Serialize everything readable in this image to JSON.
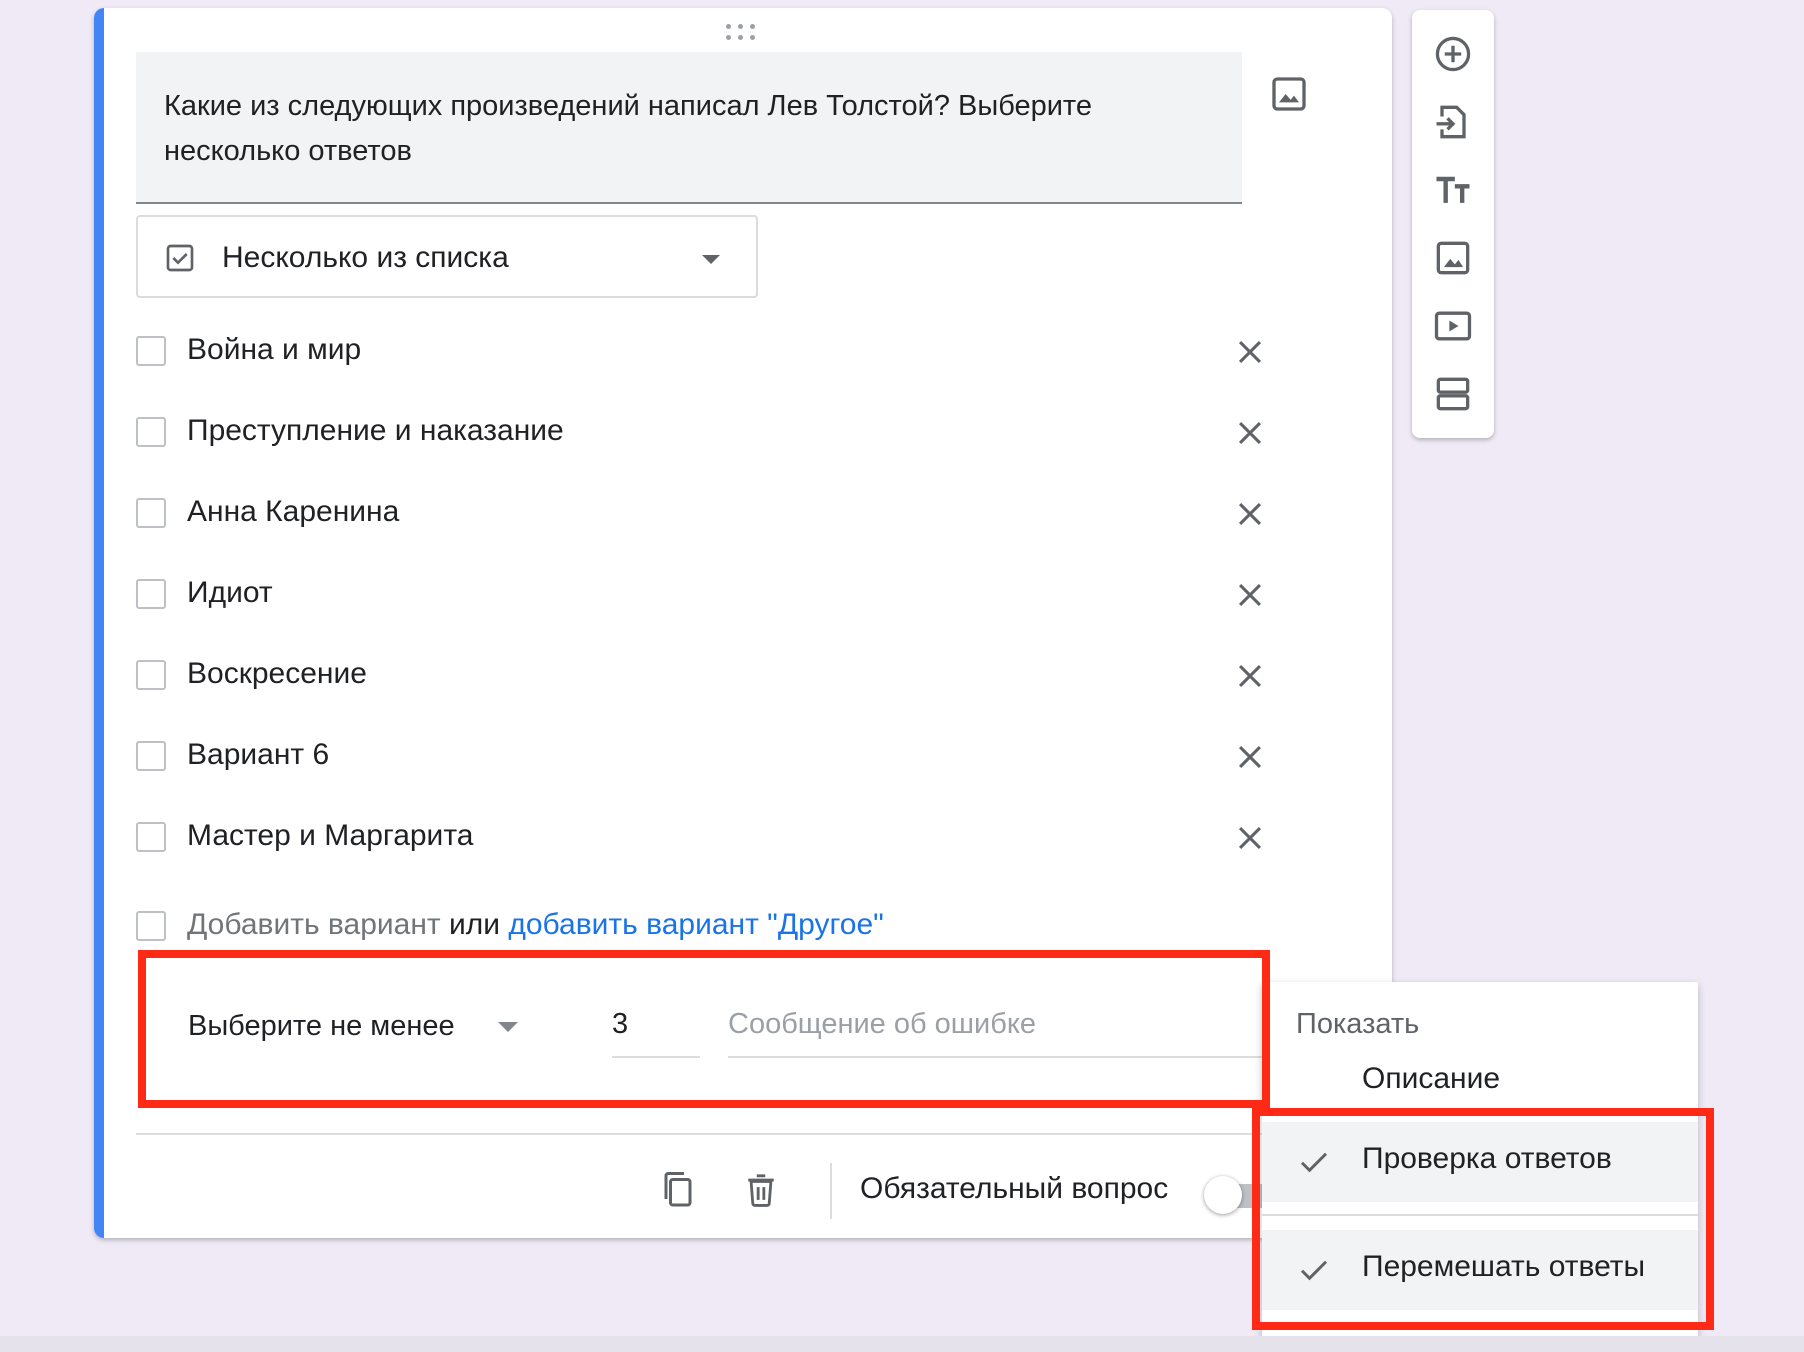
{
  "question": {
    "title": "Какие из следующих произведений написал Лев Толстой? Выберите несколько ответов",
    "type_label": "Несколько из списка"
  },
  "options": [
    {
      "label": "Война и мир"
    },
    {
      "label": "Преступление и наказание"
    },
    {
      "label": "Анна Каренина"
    },
    {
      "label": "Идиот"
    },
    {
      "label": "Воскресение"
    },
    {
      "label": "Вариант 6"
    },
    {
      "label": "Мастер и Маргарита"
    }
  ],
  "add_option": {
    "add_label": "Добавить вариант",
    "or_label": "или",
    "other_link": "добавить вариант \"Другое\""
  },
  "validation": {
    "rule_label": "Выберите не менее",
    "count_value": "3",
    "error_placeholder": "Сообщение об ошибке"
  },
  "footer": {
    "required_label": "Обязательный вопрос",
    "required_on": false
  },
  "menu": {
    "heading": "Показать",
    "items": [
      {
        "label": "Описание",
        "checked": false
      },
      {
        "label": "Проверка ответов",
        "checked": true
      },
      {
        "label": "Перемешать ответы",
        "checked": true
      }
    ]
  },
  "colors": {
    "accent": "#4285f4",
    "link": "#1a73e8",
    "highlight": "#ff2a16",
    "background": "#efeaf6"
  },
  "icons": {
    "toolbar": [
      "add-question-icon",
      "import-questions-icon",
      "add-title-icon",
      "add-image-icon",
      "add-video-icon",
      "add-section-icon"
    ],
    "footer": [
      "duplicate-icon",
      "delete-icon"
    ]
  }
}
